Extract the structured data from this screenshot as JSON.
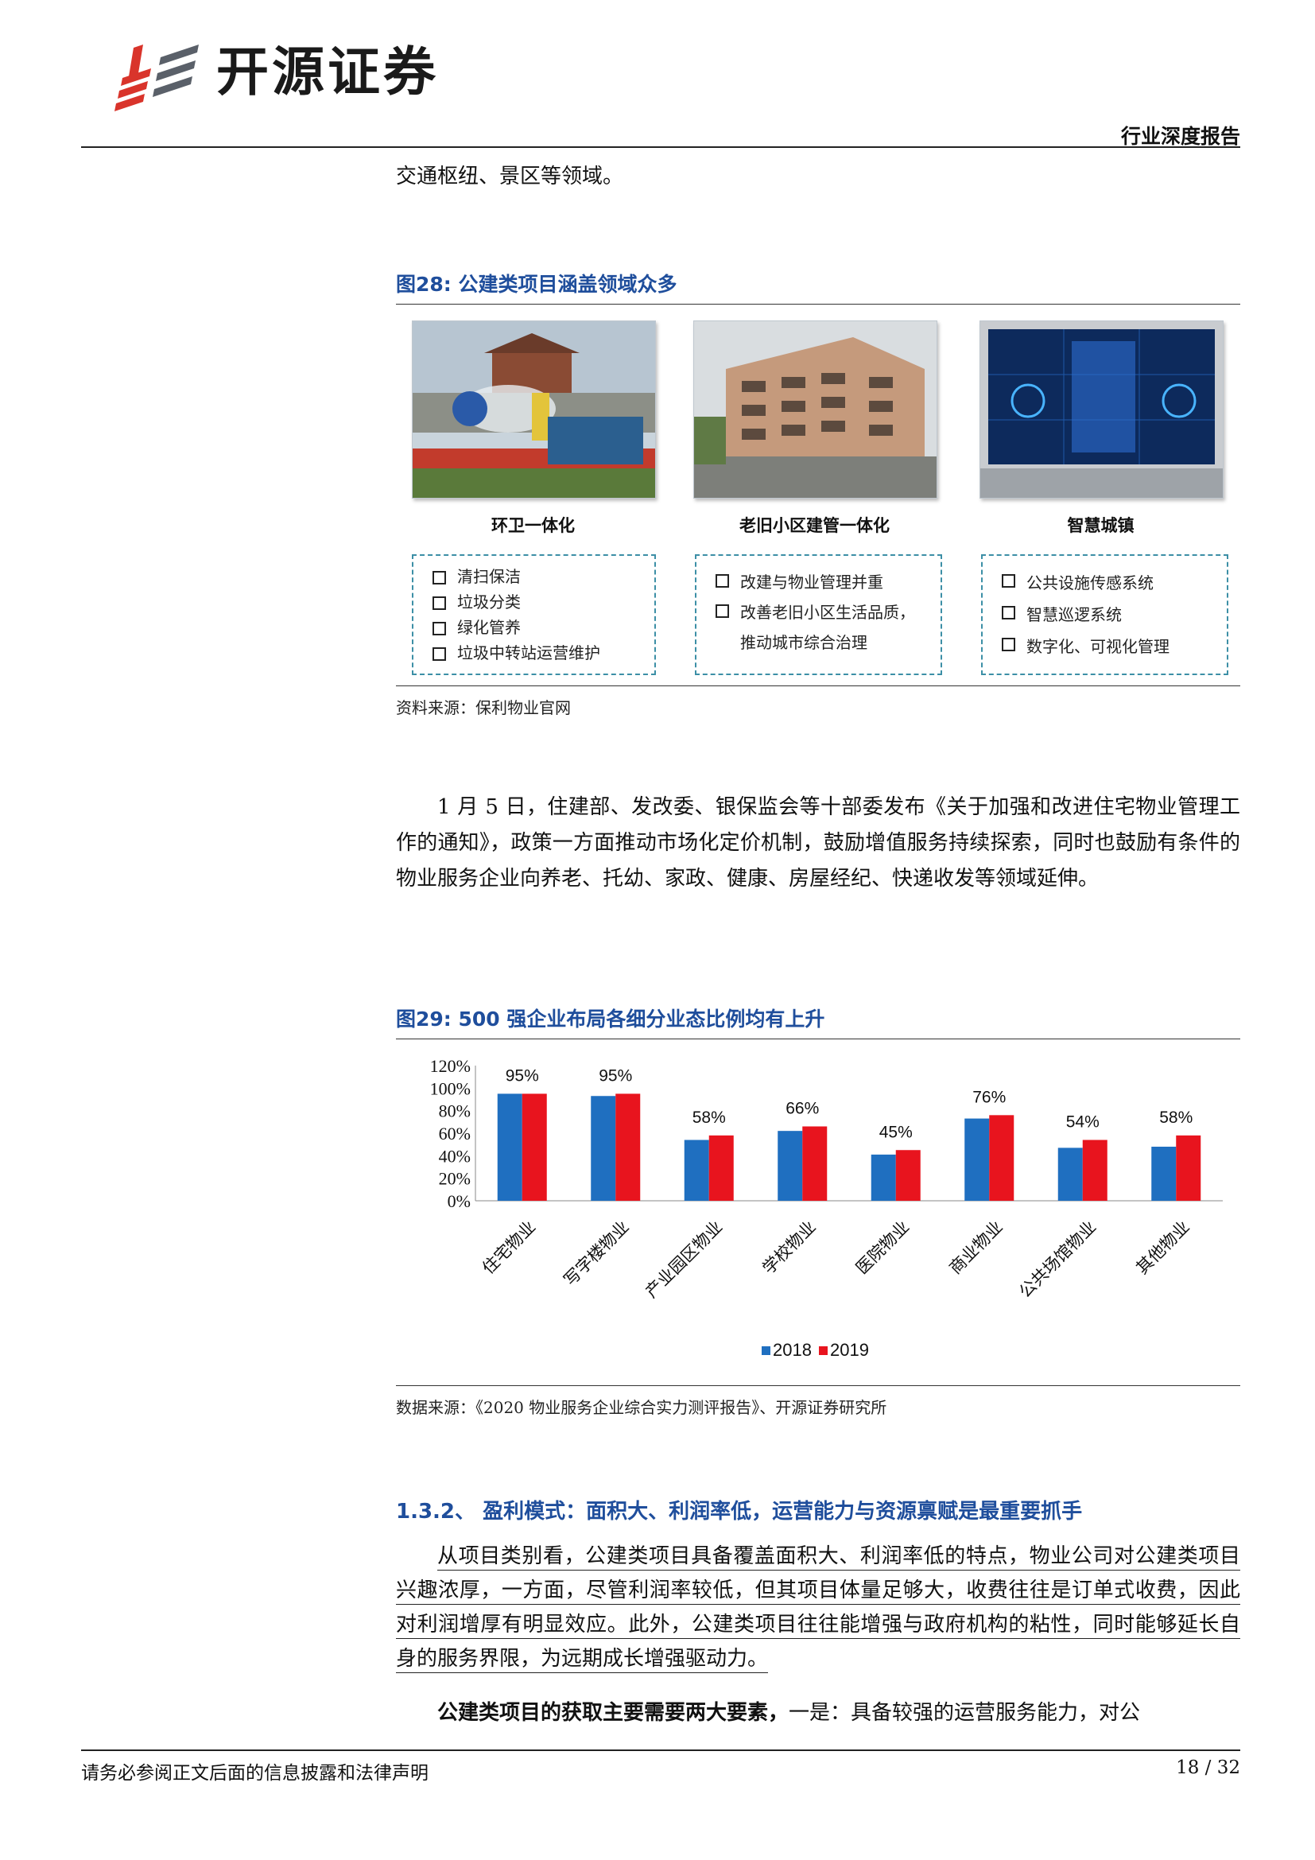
{
  "header": {
    "brand": "开源证券",
    "report_type": "行业深度报告"
  },
  "intro_line": "交通枢纽、景区等领域。",
  "figure28": {
    "title": "图28:  公建类项目涵盖领域众多",
    "panels": [
      {
        "caption": "环卫一体化",
        "items": [
          "清扫保洁",
          "垃圾分类",
          "绿化管养",
          "垃圾中转站运营维护"
        ]
      },
      {
        "caption": "老旧小区建管一体化",
        "items": [
          "改建与物业管理并重",
          "改善老旧小区生活品质，推动城市综合治理"
        ]
      },
      {
        "caption": "智慧城镇",
        "items": [
          "公共设施传感系统",
          "智慧巡逻系统",
          "数字化、可视化管理"
        ]
      }
    ],
    "source": "资料来源：保利物业官网"
  },
  "paragraph1": "1 月 5 日，住建部、发改委、银保监会等十部委发布《关于加强和改进住宅物业管理工作的通知》，政策一方面推动市场化定价机制，鼓励增值服务持续探索，同时也鼓励有条件的物业服务企业向养老、托幼、家政、健康、房屋经纪、快递收发等领域延伸。",
  "figure29": {
    "title": "图29:  500 强企业布局各细分业态比例均有上升",
    "source": "数据来源：《2020 物业服务企业综合实力测评报告》、开源证券研究所"
  },
  "chart_data": {
    "type": "bar",
    "categories": [
      "住宅物业",
      "写字楼物业",
      "产业园区物业",
      "学校物业",
      "医院物业",
      "商业物业",
      "公共场馆物业",
      "其他物业"
    ],
    "series": [
      {
        "name": "2018",
        "color": "#1f6fc0",
        "values": [
          95,
          93,
          54,
          62,
          41,
          73,
          47,
          48
        ]
      },
      {
        "name": "2019",
        "color": "#e8141e",
        "values": [
          95,
          95,
          58,
          66,
          45,
          76,
          54,
          58
        ]
      }
    ],
    "data_labels": [
      "95%",
      "95%",
      "58%",
      "66%",
      "45%",
      "76%",
      "54%",
      "58%"
    ],
    "y_ticks": [
      "0%",
      "20%",
      "40%",
      "60%",
      "80%",
      "100%",
      "120%"
    ],
    "ylim": [
      0,
      120
    ],
    "legend": "bottom-center",
    "grid": false
  },
  "section": {
    "title": "1.3.2、  盈利模式：面积大、利润率低，运营能力与资源禀赋是最重要抓手",
    "paragraph": "从项目类别看，公建类项目具备覆盖面积大、利润率低的特点，物业公司对公建类项目兴趣浓厚，一方面，尽管利润率较低，但其项目体量足够大，收费往往是订单式收费，因此对利润增厚有明显效应。此外，公建类项目往往能增强与政府机构的粘性，同时能够延长自身的服务界限，为远期成长增强驱动力。",
    "last_bold": "公建类项目的获取主要需要两大要素，",
    "last_rest": "一是：具备较强的运营服务能力，对公"
  },
  "footer": {
    "disclaimer": "请务必参阅正文后面的信息披露和法律声明",
    "page": "18 / 32"
  }
}
